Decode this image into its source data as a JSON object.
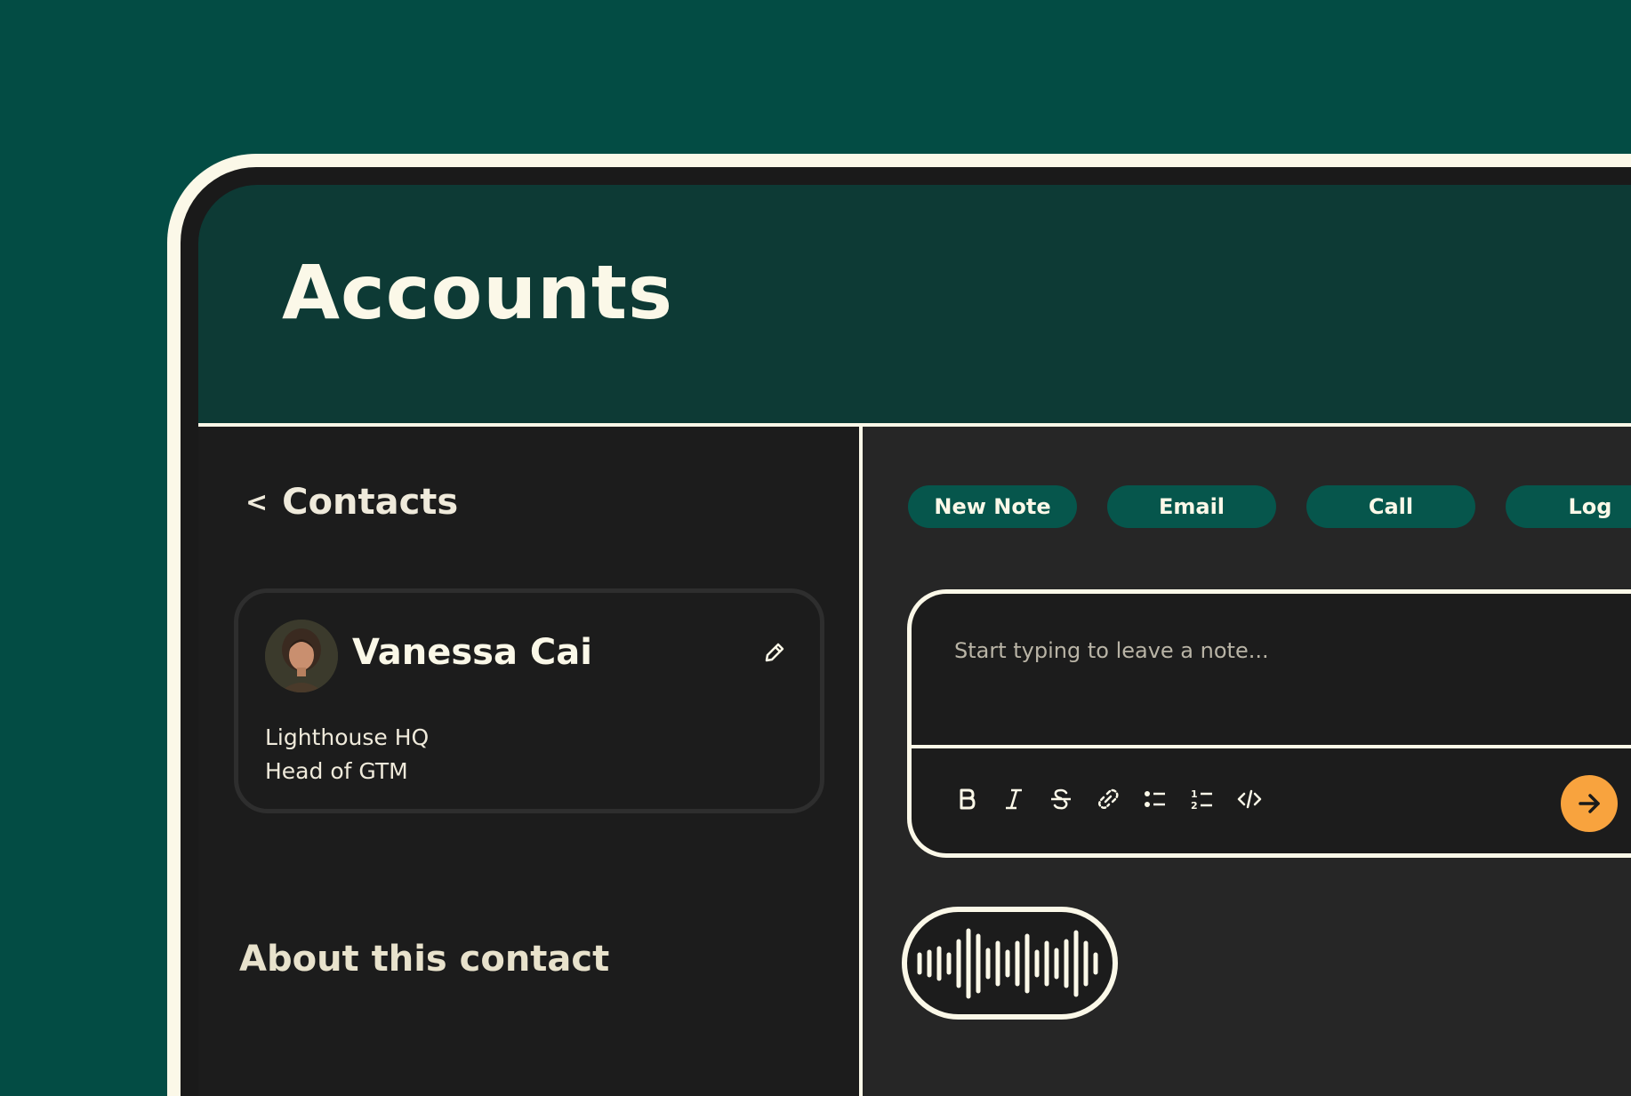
{
  "header": {
    "title": "Accounts"
  },
  "contacts_nav": {
    "back_label": "Contacts"
  },
  "contact": {
    "name": "Vanessa Cai",
    "company": "Lighthouse HQ",
    "role": "Head of GTM"
  },
  "about": {
    "heading": "About this contact"
  },
  "actions": [
    {
      "label": "New Note"
    },
    {
      "label": "Email"
    },
    {
      "label": "Call"
    },
    {
      "label": "Log"
    }
  ],
  "note": {
    "placeholder": "Start typing to leave a note..."
  },
  "toolbar": {
    "tools": [
      "bold-icon",
      "italic-icon",
      "strikethrough-icon",
      "link-icon",
      "bullet-list-icon",
      "numbered-list-icon",
      "code-icon"
    ]
  },
  "colors": {
    "background": "#034c44",
    "header": "#0d3a35",
    "frame": "#fbf8e8",
    "action_button": "#06564c",
    "send_button": "#f8a33e"
  }
}
